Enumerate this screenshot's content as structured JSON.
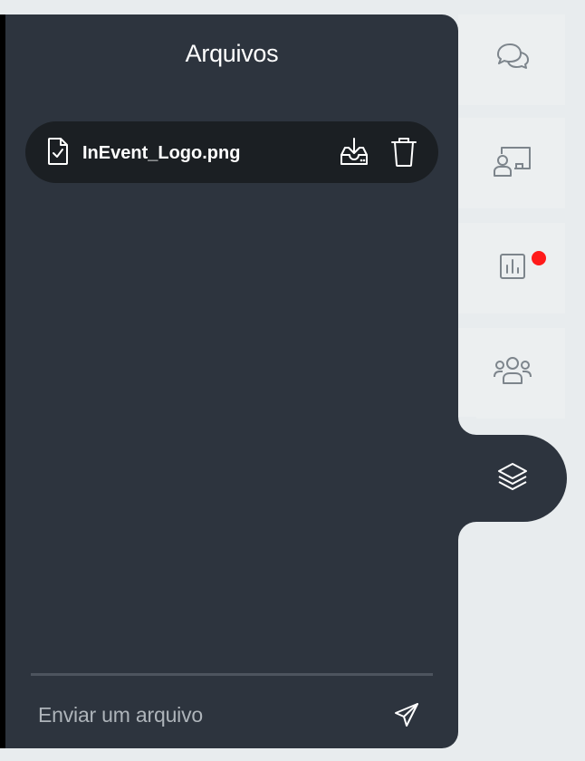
{
  "panel": {
    "title": "Arquivos"
  },
  "files": [
    {
      "name": "InEvent_Logo.png",
      "icon": "file-check-icon",
      "actions": [
        "download-icon",
        "trash-icon"
      ]
    }
  ],
  "upload": {
    "placeholder": "Enviar um arquivo",
    "send_icon": "paper-plane-icon"
  },
  "tabs": [
    {
      "name": "chat",
      "icon": "chat-bubbles-icon",
      "active": false,
      "notification": false
    },
    {
      "name": "presenter",
      "icon": "presenter-screen-icon",
      "active": false,
      "notification": false
    },
    {
      "name": "polls",
      "icon": "bar-chart-icon",
      "active": false,
      "notification": true
    },
    {
      "name": "people",
      "icon": "people-group-icon",
      "active": false,
      "notification": false
    },
    {
      "name": "files",
      "icon": "layers-icon",
      "active": true,
      "notification": false
    }
  ],
  "colors": {
    "panel_bg": "#2d343e",
    "file_row_bg": "#1b1f23",
    "page_bg": "#e8ecee",
    "notification": "#ff1a1a",
    "tab_icon": "#7d858c"
  }
}
